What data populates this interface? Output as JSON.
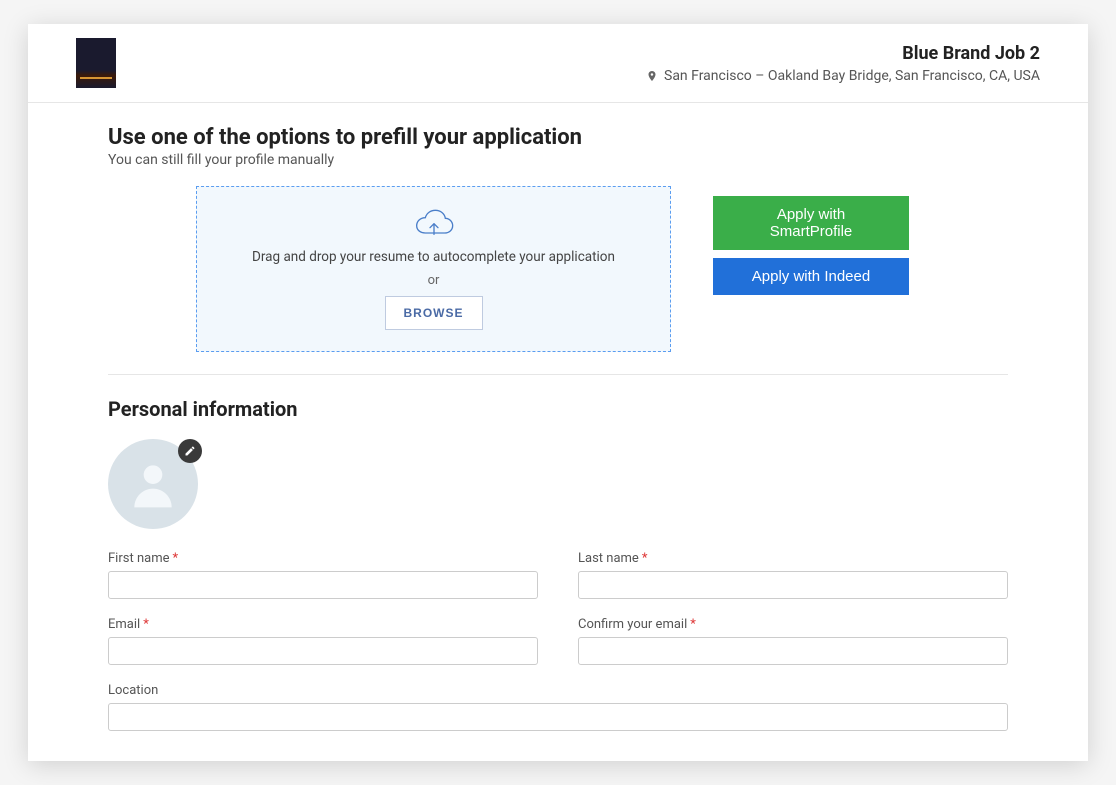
{
  "header": {
    "job_title": "Blue Brand Job 2",
    "location": "San Francisco – Oakland Bay Bridge, San Francisco, CA, USA"
  },
  "prefill": {
    "title": "Use one of the options to prefill your application",
    "subtitle": "You can still fill your profile manually",
    "dropzone_text": "Drag and drop your resume to autocomplete your application",
    "or": "or",
    "browse": "BROWSE",
    "apply_smartprofile": "Apply with SmartProfile",
    "apply_indeed": "Apply with Indeed"
  },
  "personal": {
    "section_title": "Personal information",
    "fields": {
      "first_name": {
        "label": "First name",
        "value": "",
        "required": true
      },
      "last_name": {
        "label": "Last name",
        "value": "",
        "required": true
      },
      "email": {
        "label": "Email",
        "value": "",
        "required": true
      },
      "confirm_email": {
        "label": "Confirm your email",
        "value": "",
        "required": true
      },
      "location": {
        "label": "Location",
        "value": "",
        "required": false
      }
    }
  },
  "colors": {
    "green": "#3aae49",
    "blue": "#2170d9",
    "dashed_border": "#5b9df0",
    "dropzone_bg": "#f2f8fd"
  }
}
